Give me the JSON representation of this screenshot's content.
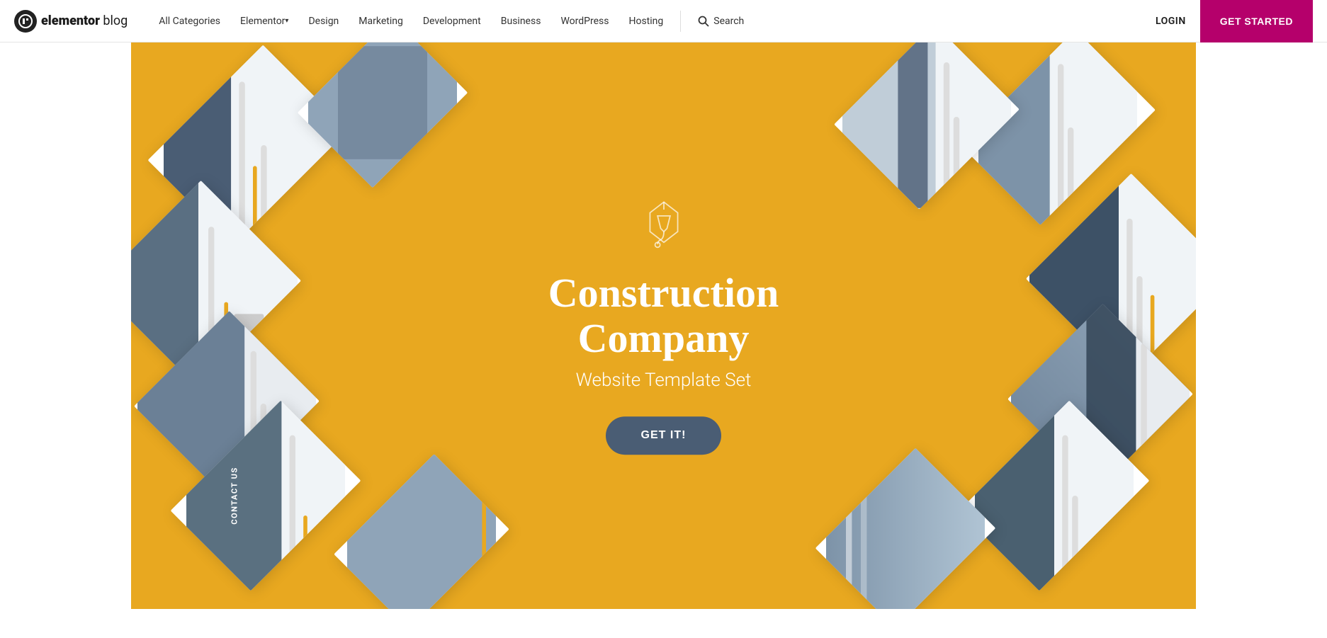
{
  "logo": {
    "icon": "E",
    "brand": "elementor",
    "suffix": " blog"
  },
  "navbar": {
    "links": [
      {
        "label": "All Categories",
        "hasArrow": false
      },
      {
        "label": "Elementor",
        "hasArrow": true
      },
      {
        "label": "Design",
        "hasArrow": false
      },
      {
        "label": "Marketing",
        "hasArrow": false
      },
      {
        "label": "Development",
        "hasArrow": false
      },
      {
        "label": "Business",
        "hasArrow": false
      },
      {
        "label": "WordPress",
        "hasArrow": false
      },
      {
        "label": "Hosting",
        "hasArrow": false
      }
    ],
    "search_label": "Search",
    "login_label": "LOGIN",
    "cta_label": "GET STARTED"
  },
  "hero": {
    "title": "Construction Company",
    "subtitle": "Website Template Set",
    "cta_label": "GET IT!",
    "bg_color": "#E8A820",
    "btn_color": "#4a5d74"
  }
}
